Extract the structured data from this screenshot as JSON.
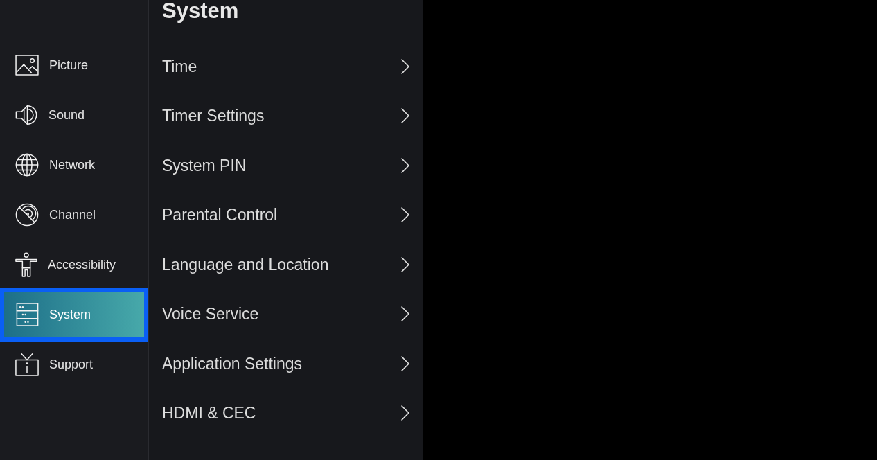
{
  "sidebar": {
    "items": [
      {
        "label": "Picture",
        "selected": false
      },
      {
        "label": "Sound",
        "selected": false
      },
      {
        "label": "Network",
        "selected": false
      },
      {
        "label": "Channel",
        "selected": false
      },
      {
        "label": "Accessibility",
        "selected": false
      },
      {
        "label": "System",
        "selected": true
      },
      {
        "label": "Support",
        "selected": false
      }
    ]
  },
  "panel": {
    "title": "System",
    "items": [
      {
        "label": "Time"
      },
      {
        "label": "Timer Settings"
      },
      {
        "label": "System PIN"
      },
      {
        "label": "Parental Control"
      },
      {
        "label": "Language and Location"
      },
      {
        "label": "Voice Service"
      },
      {
        "label": "Application Settings"
      },
      {
        "label": "HDMI & CEC"
      }
    ]
  }
}
